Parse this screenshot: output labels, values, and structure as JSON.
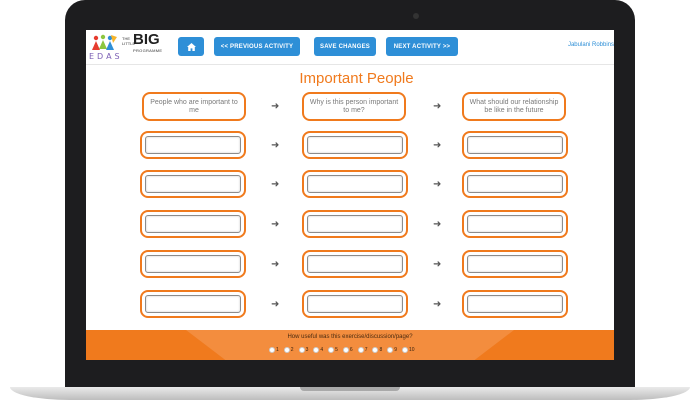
{
  "app": {
    "logo": {
      "edas": "EDAS",
      "the": "THE LITTLE",
      "big": "BIG",
      "programme": "PROGRAMME"
    },
    "nav": {
      "home_icon": "home-icon",
      "previous_label": "<< PREVIOUS ACTIVITY",
      "save_label": "SAVE CHANGES",
      "next_label": "NEXT ACTIVITY >>"
    },
    "user_name": "Jabulani Robbins"
  },
  "page": {
    "title": "Important People",
    "columns": [
      "People who are important to me",
      "Why is this person important to me?",
      "What should our relationship be like in the future"
    ],
    "rows": [
      [
        "",
        "",
        ""
      ],
      [
        "",
        "",
        ""
      ],
      [
        "",
        "",
        ""
      ],
      [
        "",
        "",
        ""
      ],
      [
        "",
        "",
        ""
      ]
    ]
  },
  "feedback": {
    "question": "How useful was this exercise/discussion/page?",
    "options": [
      "1",
      "2",
      "3",
      "4",
      "5",
      "6",
      "7",
      "8",
      "9",
      "10"
    ]
  },
  "colors": {
    "accent": "#f07a1d",
    "button": "#2e8fd7"
  }
}
